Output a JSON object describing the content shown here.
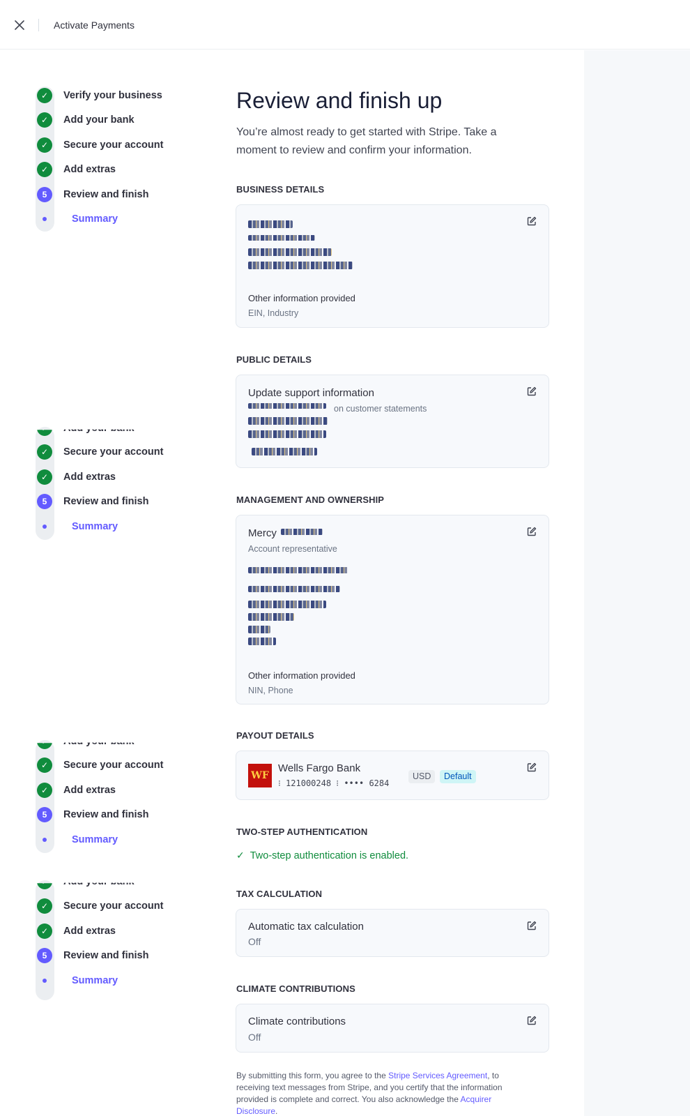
{
  "topbar": {
    "title": "Activate Payments"
  },
  "stepper": {
    "steps": [
      "Verify your business",
      "Add your bank",
      "Secure your account",
      "Add extras",
      "Review and finish"
    ],
    "active_number": "5",
    "substep": "Summary"
  },
  "header": {
    "title": "Review and finish up",
    "description": "You’re almost ready to get started with Stripe. Take a moment to review and confirm your information."
  },
  "business": {
    "heading": "BUSINESS DETAILS",
    "other_label": "Other information provided",
    "other_value": "EIN, Industry"
  },
  "public": {
    "heading": "PUBLIC DETAILS",
    "title": "Update support information",
    "note": "on customer statements"
  },
  "management": {
    "heading": "MANAGEMENT AND OWNERSHIP",
    "name_first": "Mercy",
    "role": "Account representative",
    "other_label": "Other information provided",
    "other_value": "NIN, Phone"
  },
  "payout": {
    "heading": "PAYOUT DETAILS",
    "bank_logo": "WF",
    "bank_name": "Wells Fargo Bank",
    "account_line": "⁝ 121000248 ⁝ •••• 6284",
    "currency": "USD",
    "default_badge": "Default"
  },
  "twostep": {
    "heading": "TWO-STEP AUTHENTICATION",
    "status": "Two-step authentication is enabled."
  },
  "tax": {
    "heading": "TAX CALCULATION",
    "title": "Automatic tax calculation",
    "value": "Off"
  },
  "climate": {
    "heading": "CLIMATE CONTRIBUTIONS",
    "title": "Climate contributions",
    "value": "Off"
  },
  "legal": {
    "text1": "By submitting this form, you agree to the ",
    "link1": "Stripe Services Agreement",
    "text2": ", to receiving text messages from Stripe, and you certify that the information provided is complete and correct. You also acknowledge the ",
    "link2": "Acquirer Disclosure",
    "text3": "."
  },
  "colors": {
    "accent": "#635bff",
    "success": "#108c3d",
    "wells_fargo_red": "#c3110c"
  },
  "icons": {
    "close": "close-icon",
    "edit": "edit-icon",
    "check": "check-icon"
  }
}
